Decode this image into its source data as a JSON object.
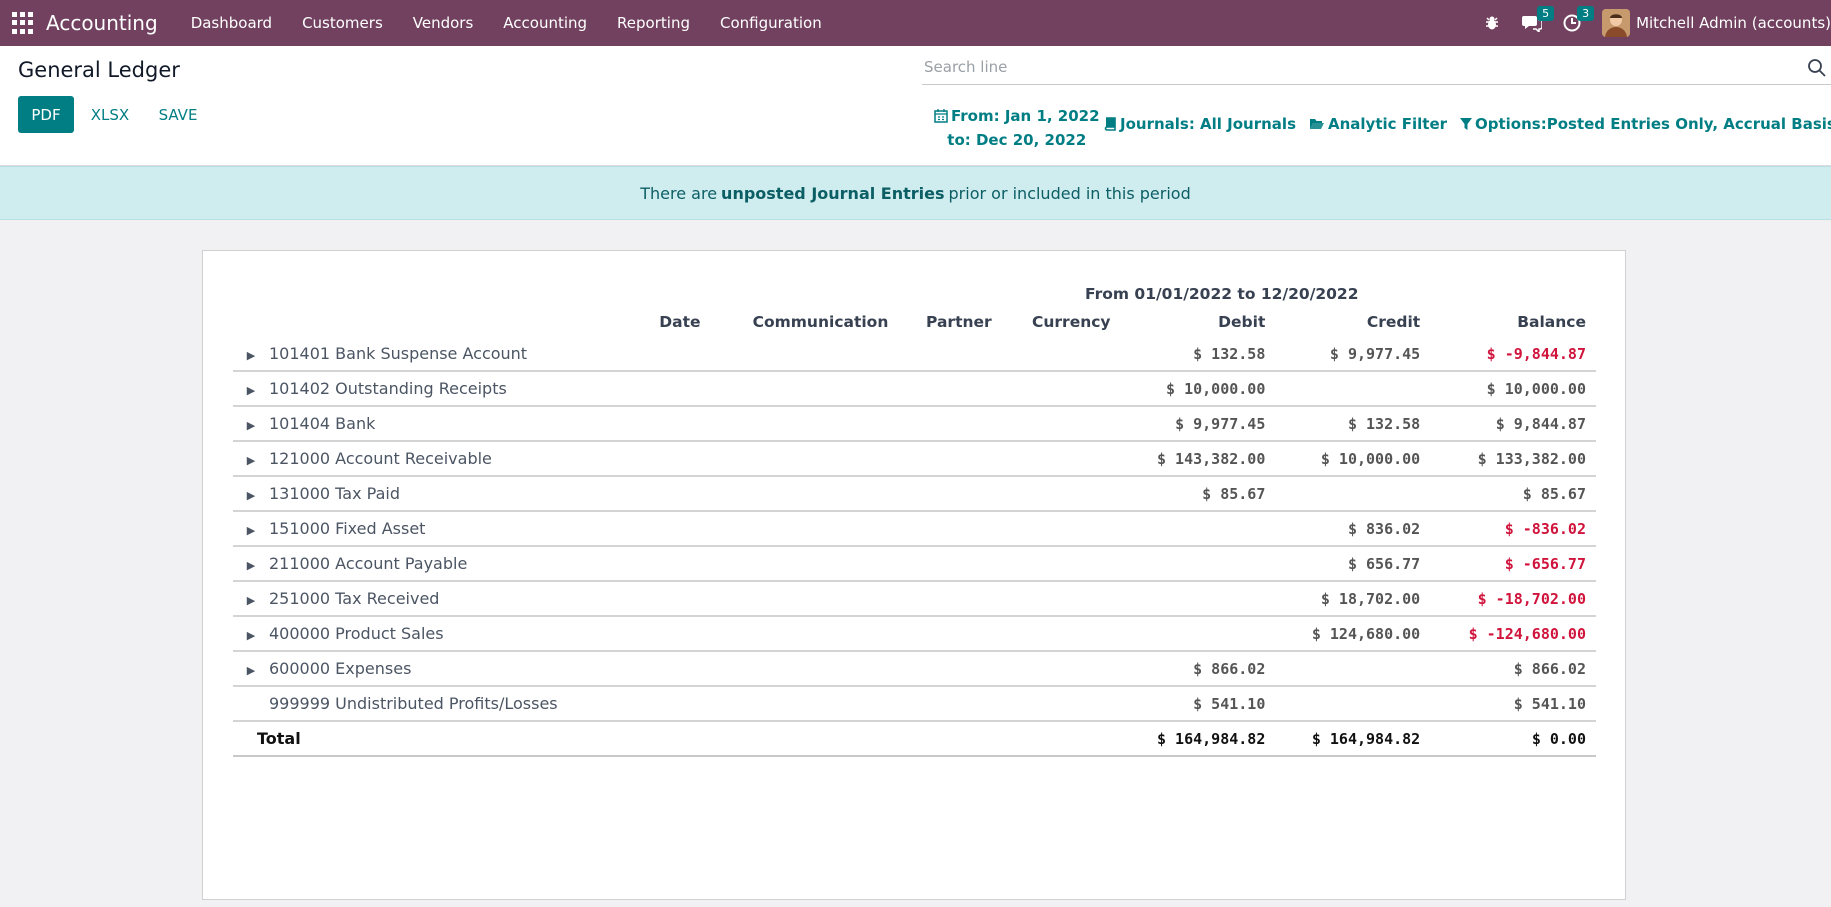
{
  "navbar": {
    "app_name": "Accounting",
    "menu": [
      "Dashboard",
      "Customers",
      "Vendors",
      "Accounting",
      "Reporting",
      "Configuration"
    ],
    "messages_count": "5",
    "activities_count": "3",
    "user_name": "Mitchell Admin (accounts)"
  },
  "control_panel": {
    "title": "General Ledger",
    "buttons": {
      "pdf": "PDF",
      "xlsx": "XLSX",
      "save": "SAVE"
    },
    "search": {
      "placeholder": "Search line"
    },
    "filters": {
      "date_from": "From: Jan 1, 2022",
      "date_to": "to: Dec 20, 2022",
      "journals": "Journals: All Journals",
      "analytic": "Analytic Filter",
      "options": "Options:Posted Entries Only, Accrual Basis"
    }
  },
  "alert": {
    "before": "There are",
    "link": "unposted Journal Entries",
    "after": "prior or included in this period"
  },
  "report": {
    "period": "From 01/01/2022 to 12/20/2022",
    "columns": [
      "Date",
      "Communication",
      "Partner",
      "Currency",
      "Debit",
      "Credit",
      "Balance"
    ],
    "rows": [
      {
        "name": "101401 Bank Suspense Account",
        "expandable": true,
        "debit": "$ 132.58",
        "credit": "$ 9,977.45",
        "balance": "$ -9,844.87",
        "negative": true
      },
      {
        "name": "101402 Outstanding Receipts",
        "expandable": true,
        "debit": "$ 10,000.00",
        "credit": "",
        "balance": "$ 10,000.00",
        "negative": false
      },
      {
        "name": "101404 Bank",
        "expandable": true,
        "debit": "$ 9,977.45",
        "credit": "$ 132.58",
        "balance": "$ 9,844.87",
        "negative": false
      },
      {
        "name": "121000 Account Receivable",
        "expandable": true,
        "debit": "$ 143,382.00",
        "credit": "$ 10,000.00",
        "balance": "$ 133,382.00",
        "negative": false
      },
      {
        "name": "131000 Tax Paid",
        "expandable": true,
        "debit": "$ 85.67",
        "credit": "",
        "balance": "$ 85.67",
        "negative": false
      },
      {
        "name": "151000 Fixed Asset",
        "expandable": true,
        "debit": "",
        "credit": "$ 836.02",
        "balance": "$ -836.02",
        "negative": true
      },
      {
        "name": "211000 Account Payable",
        "expandable": true,
        "debit": "",
        "credit": "$ 656.77",
        "balance": "$ -656.77",
        "negative": true
      },
      {
        "name": "251000 Tax Received",
        "expandable": true,
        "debit": "",
        "credit": "$ 18,702.00",
        "balance": "$ -18,702.00",
        "negative": true
      },
      {
        "name": "400000 Product Sales",
        "expandable": true,
        "debit": "",
        "credit": "$ 124,680.00",
        "balance": "$ -124,680.00",
        "negative": true
      },
      {
        "name": "600000 Expenses",
        "expandable": true,
        "debit": "$ 866.02",
        "credit": "",
        "balance": "$ 866.02",
        "negative": false
      },
      {
        "name": "999999 Undistributed Profits/Losses",
        "expandable": false,
        "debit": "$ 541.10",
        "credit": "",
        "balance": "$ 541.10",
        "negative": false
      }
    ],
    "total": {
      "label": "Total",
      "debit": "$ 164,984.82",
      "credit": "$ 164,984.82",
      "balance": "$ 0.00"
    }
  },
  "colors": {
    "navbar": "#71415f",
    "accent": "#017e84",
    "negative": "#d0143c",
    "alert_bg": "#cfecef"
  }
}
